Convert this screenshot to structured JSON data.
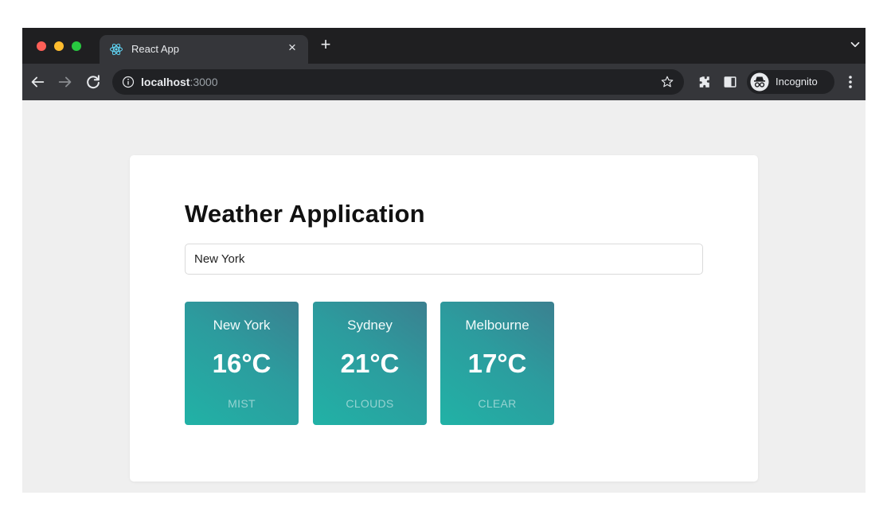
{
  "browser": {
    "tab": {
      "title": "React App",
      "icon": "react-logo-icon",
      "close_glyph": "×"
    },
    "new_tab_glyph": "+",
    "url_host": "localhost",
    "url_port": ":3000",
    "profile_label": "Incognito",
    "colors": {
      "tabstrip": "#1f1f21",
      "toolbar": "#35363a",
      "omnibox": "#202124"
    }
  },
  "app": {
    "title": "Weather Application",
    "search": {
      "value": "New York",
      "placeholder": ""
    }
  },
  "weather_cards": [
    {
      "city": "New York",
      "temperature": "16°C",
      "condition": "MIST"
    },
    {
      "city": "Sydney",
      "temperature": "21°C",
      "condition": "CLOUDS"
    },
    {
      "city": "Melbourne",
      "temperature": "17°C",
      "condition": "CLEAR"
    }
  ],
  "colors": {
    "card_gradient_start": "#21b2a6",
    "card_gradient_end": "#3b8090",
    "page_bg": "#efefef"
  }
}
